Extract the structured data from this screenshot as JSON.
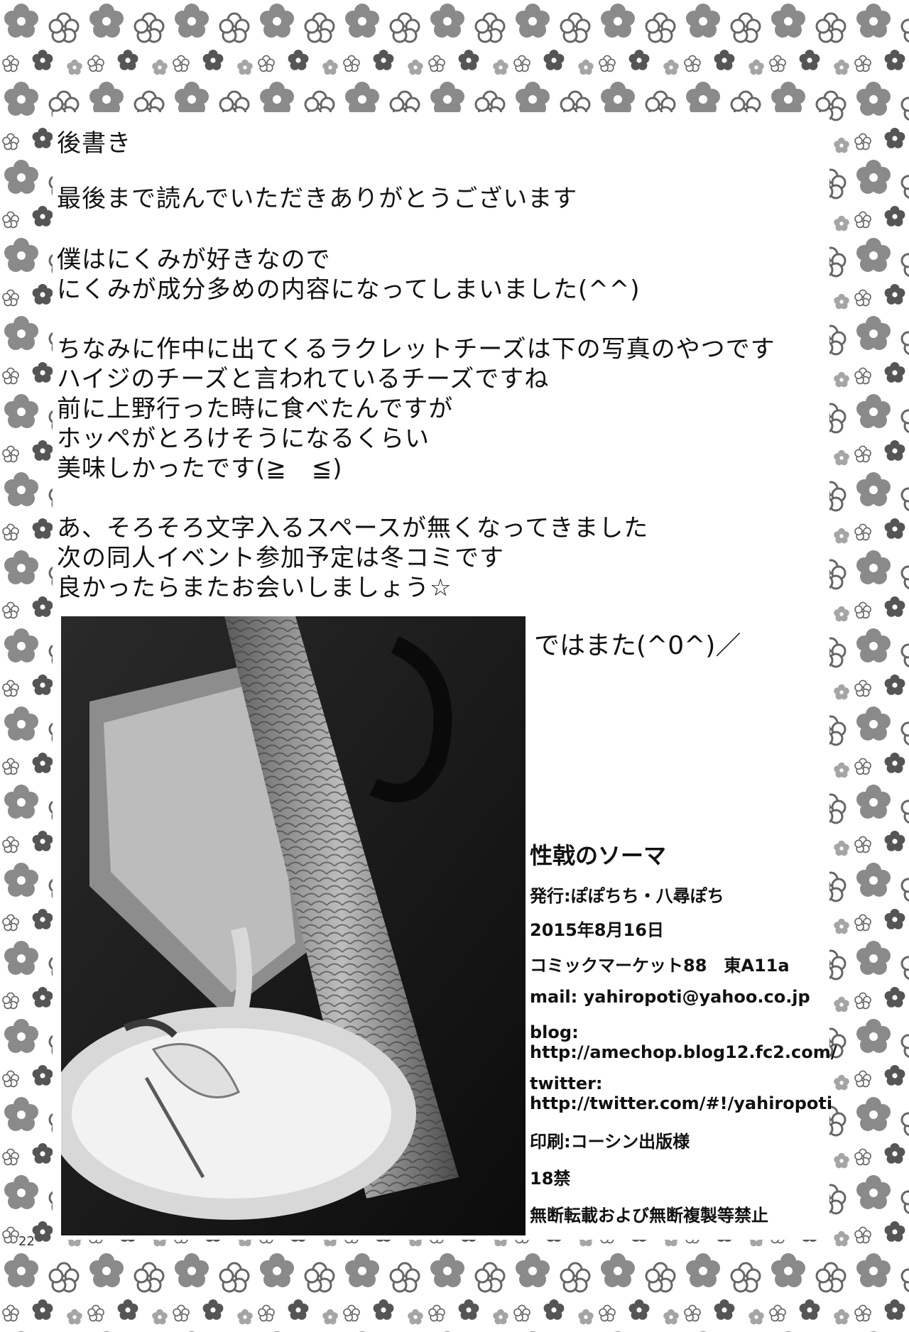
{
  "afterword": {
    "title": "後書き",
    "thanks": "最後まで読んでいただきありがとうございます",
    "para1": [
      "僕はにくみが好きなので",
      "にくみが成分多めの内容になってしまいました(^^)"
    ],
    "para2": [
      "ちなみに作中に出てくるラクレットチーズは下の写真のやつです",
      "ハイジのチーズと言われているチーズですね",
      "前に上野行った時に食べたんですが",
      "ホッペがとろけそうになるくらい",
      "美味しかったです(≧　≦)"
    ],
    "para3": [
      "あ、そろそろ文字入るスペースが無くなってきました",
      "次の同人イベント参加予定は冬コミです",
      "良かったらまたお会いしましょう☆"
    ],
    "farewell": "ではまた(^0^)／"
  },
  "colophon": {
    "title": "性戟のソーマ",
    "publisher": "発行:ぽぽちち・八尋ぽち",
    "date": "2015年8月16日",
    "event": "コミックマーケット88　東A11a",
    "mail": "mail: yahiropoti@yahoo.co.jp",
    "blog_label": "blog:",
    "blog_url": "http://amechop.blog12.fc2.com/",
    "twitter_label": "twitter:",
    "twitter_url": "http://twitter.com/#!/yahiropoti",
    "printer": "印刷:コーシン出版様",
    "rating": "18禁",
    "copyright": "無断転載および無断複製等禁止"
  },
  "page_number": "22",
  "colors": {
    "border_flower": "#8a8a8a",
    "photo_bg": "#1a1a1a"
  }
}
